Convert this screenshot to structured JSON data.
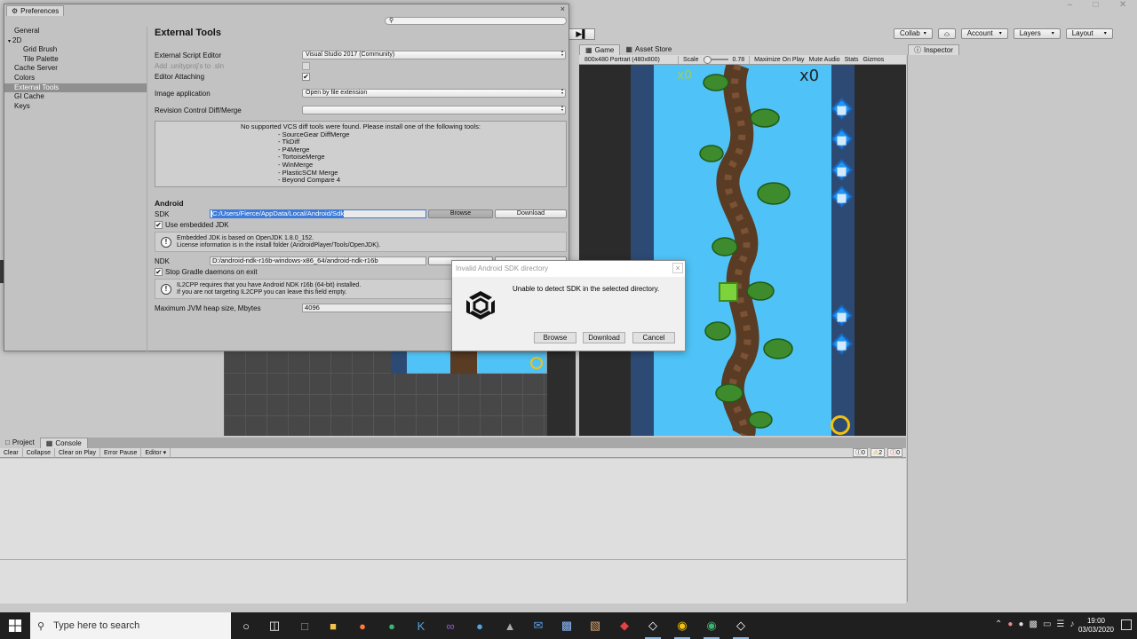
{
  "prefs": {
    "title": "Preferences",
    "close": "×",
    "sidebar": [
      {
        "label": "General",
        "level": 0
      },
      {
        "label": "2D",
        "level": 0,
        "toggle": "▾"
      },
      {
        "label": "Grid Brush",
        "level": 1
      },
      {
        "label": "Tile Palette",
        "level": 1
      },
      {
        "label": "Cache Server",
        "level": 0
      },
      {
        "label": "Colors",
        "level": 0
      },
      {
        "label": "External Tools",
        "level": 0,
        "selected": true
      },
      {
        "label": "GI Cache",
        "level": 0
      },
      {
        "label": "Keys",
        "level": 0
      }
    ],
    "heading": "External Tools",
    "script_editor_label": "External Script Editor",
    "script_editor_value": "Visual Studio 2017 (Community)",
    "add_unityproj_label": "Add .unityproj's to .sln",
    "editor_attaching_label": "Editor Attaching",
    "image_app_label": "Image application",
    "image_app_value": "Open by file extension",
    "revision_label": "Revision Control Diff/Merge",
    "revision_value": "",
    "vcs_message": "No supported VCS diff tools were found. Please install one of the following tools:",
    "vcs_tools": [
      "- SourceGear DiffMerge",
      "- TkDiff",
      "- P4Merge",
      "- TortoiseMerge",
      "- WinMerge",
      "- PlasticSCM Merge",
      "- Beyond Compare 4"
    ],
    "android_heading": "Android",
    "sdk_label": "SDK",
    "sdk_path": "C:/Users/Fierce/AppData/Local/Android/Sdk",
    "browse": "Browse",
    "download": "Download",
    "use_jdk_label": "Use embedded JDK",
    "jdk_help_1": "Embedded JDK is based on OpenJDK 1.8.0_152.",
    "jdk_help_2": "License information is in the install folder (AndroidPlayer/Tools/OpenJDK).",
    "help_icon": "!",
    "ndk_label": "NDK",
    "ndk_path": "D:/android-ndk-r16b-windows-x86_64/android-ndk-r16b",
    "stop_gradle_label": "Stop Gradle daemons on exit",
    "il2cpp_help_1": "IL2CPP requires that you have Android NDK r16b (64-bit) installed.",
    "il2cpp_help_2": "If you are not targeting IL2CPP you can leave this field empty.",
    "jvm_label": "Maximum JVM heap size, Mbytes",
    "jvm_value": "4096",
    "check": "✔"
  },
  "dialog": {
    "title": "Invalid Android SDK directory",
    "message": "Unable to detect SDK in the selected directory.",
    "close": "×",
    "browse": "Browse",
    "download": "Download",
    "cancel": "Cancel"
  },
  "toolbar": {
    "collab": "Collab",
    "account": "Account",
    "layers": "Layers",
    "layout": "Layout",
    "arrow": "▾",
    "step": "▶▌"
  },
  "game": {
    "tab_game": "Game",
    "tab_asset_store": "Asset Store",
    "resolution": "800x480 Portrait (480x800)",
    "scale_label": "Scale",
    "scale_value": "0.78",
    "maximize": "Maximize On Play",
    "mute": "Mute Audio",
    "stats": "Stats",
    "gizmos": "Gizmos",
    "score": "x0",
    "score_green": "x0"
  },
  "inspector": {
    "tab": "Inspector"
  },
  "console": {
    "tab_project": "Project",
    "tab_console": "Console",
    "clear": "Clear",
    "collapse": "Collapse",
    "clear_on_play": "Clear on Play",
    "error_pause": "Error Pause",
    "editor": "Editor",
    "count_info": "0",
    "count_warn": "2",
    "count_error": "0"
  },
  "taskbar": {
    "search_placeholder": "Type here to search",
    "time": "19:00",
    "date": "03/03/2020"
  },
  "colors": {
    "sky": "#4fc3f7",
    "lane": "#2c4a73",
    "selection": "#3d7bd9"
  }
}
